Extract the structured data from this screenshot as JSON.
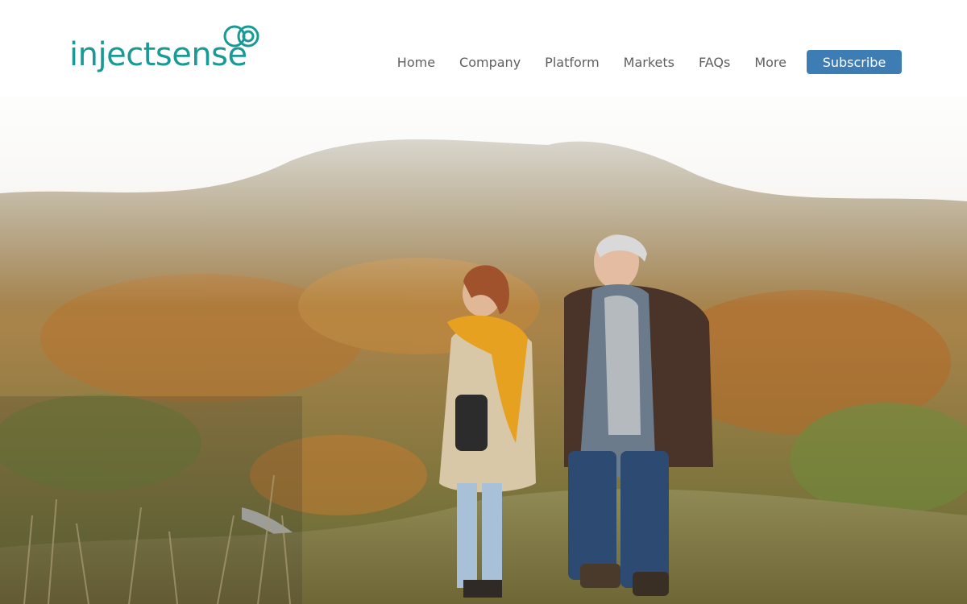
{
  "header": {
    "logo_text": "injectsense",
    "logo_icon": "linked-rings-icon",
    "nav": [
      "Home",
      "Company",
      "Platform",
      "Markets",
      "FAQs",
      "More"
    ],
    "subscribe_label": "Subscribe"
  },
  "hero": {
    "image_description_icon": "hero-photo",
    "overlay": "dark-translucent-panel"
  },
  "colors": {
    "brand_teal": "#1a9a96",
    "subscribe_blue": "#3e7cb4",
    "nav_text": "#5f5f5f"
  }
}
